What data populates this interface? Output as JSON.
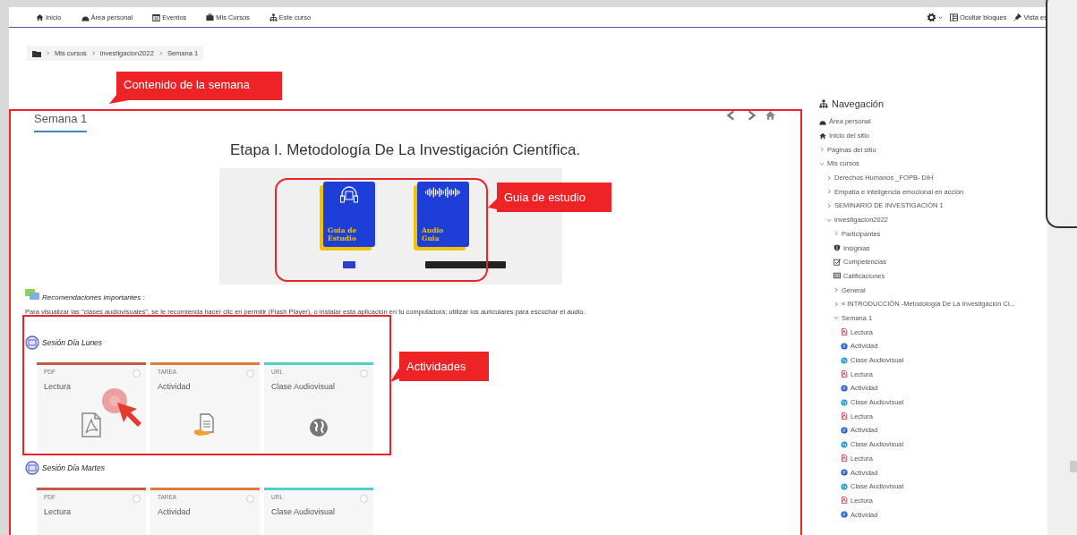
{
  "navbar": {
    "items": [
      {
        "kind": "home",
        "label": "Inicio"
      },
      {
        "kind": "dashboard",
        "label": "Área personal"
      },
      {
        "kind": "calendar",
        "label": "Eventos"
      },
      {
        "kind": "briefcase",
        "label": "Mis Cursos"
      },
      {
        "kind": "sitemap",
        "label": "Este curso"
      }
    ],
    "right": [
      {
        "kind": "gear"
      },
      {
        "kind": "columns",
        "label": "Ocultar bloques"
      },
      {
        "kind": "pin",
        "label": "Vista es"
      }
    ]
  },
  "breadcrumb": [
    "Mis cursos",
    "investigacion2022",
    "Semana 1"
  ],
  "section": {
    "tab": "Semana 1",
    "title": "Etapa I. Metodología De La Investigación Científica.",
    "covers": [
      {
        "kind": "book",
        "title": "Guia de Estudio"
      },
      {
        "kind": "audio",
        "title": "Audio Guia"
      }
    ],
    "notice_title": "Recomendaciones importantes :",
    "notice": "Para visualizar las \"clases audiovisuales\", se le recomienda hacer clic en permitir (Flash Player), o  instalar esta aplicación en tu computadora; utilizar  los auriculares para escuchar el audio.",
    "sessions": [
      {
        "title": "Sesión Día Lunes",
        "activities": [
          {
            "kind": "pdf",
            "type": "PDF",
            "name": "Lectura",
            "done": false
          },
          {
            "kind": "task",
            "type": "TAREA",
            "name": "Actividad",
            "done": false
          },
          {
            "kind": "url",
            "type": "URL",
            "name": "Clase Audiovisual",
            "done": false
          }
        ]
      },
      {
        "title": "Sesión Día Martes",
        "activities": [
          {
            "kind": "pdf",
            "type": "PDF",
            "name": "Lectura",
            "done": false
          },
          {
            "kind": "task",
            "type": "TAREA",
            "name": "Actividad",
            "done": false
          },
          {
            "kind": "url",
            "type": "URL",
            "name": "Clase Audiovisual",
            "done": false
          }
        ]
      }
    ]
  },
  "navigation": {
    "title": "Navegación",
    "items": [
      {
        "kind": "dashboard",
        "label": "Área personal"
      },
      {
        "kind": "home",
        "label": "Inicio del sitio"
      },
      {
        "kind": "branch",
        "label": "Páginas del sitio",
        "expanded": false
      },
      {
        "kind": "branch",
        "label": "Mis cursos",
        "expanded": true,
        "children": [
          {
            "kind": "branch",
            "label": "Derechos Humanos _FOPB- DIH",
            "expanded": false
          },
          {
            "kind": "branch",
            "label": "Empatía e inteligencia emocional en acción",
            "expanded": false
          },
          {
            "kind": "branch",
            "label": "SEMINARIO DE INVESTIGACIÓN 1",
            "expanded": false
          },
          {
            "kind": "branch",
            "label": "investigacion2022",
            "expanded": true,
            "children": [
              {
                "kind": "branch",
                "label": "Participantes",
                "expanded": false
              },
              {
                "kind": "badge",
                "label": "Insignias"
              },
              {
                "kind": "check",
                "label": "Competencias"
              },
              {
                "kind": "grades",
                "label": "Calificaciones"
              },
              {
                "kind": "branch",
                "label": "General",
                "expanded": false
              },
              {
                "kind": "branch",
                "label": "« INTRODUCCIÓN -Metodología De La Investigación Ci...",
                "expanded": false
              },
              {
                "kind": "branch",
                "label": "Semana 1",
                "expanded": true,
                "children": [
                  {
                    "kind": "pdf",
                    "label": "Lectura"
                  },
                  {
                    "kind": "task",
                    "label": "Actividad"
                  },
                  {
                    "kind": "url",
                    "label": "Clase Audiovisual"
                  },
                  {
                    "kind": "pdf",
                    "label": "Lectura"
                  },
                  {
                    "kind": "task",
                    "label": "Actividad"
                  },
                  {
                    "kind": "url",
                    "label": "Clase Audiovisual"
                  },
                  {
                    "kind": "pdf",
                    "label": "Lectura"
                  },
                  {
                    "kind": "task",
                    "label": "Actividad"
                  },
                  {
                    "kind": "url",
                    "label": "Clase Audiovisual"
                  },
                  {
                    "kind": "pdf",
                    "label": "Lectura"
                  },
                  {
                    "kind": "task",
                    "label": "Actividad"
                  },
                  {
                    "kind": "url",
                    "label": "Clase Audiovisual"
                  },
                  {
                    "kind": "pdf",
                    "label": "Lectura"
                  },
                  {
                    "kind": "task",
                    "label": "Actividad"
                  }
                ]
              }
            ]
          }
        ]
      }
    ]
  },
  "annotations": [
    {
      "kind": "callout",
      "text": "Contenido de la semana"
    },
    {
      "kind": "callout",
      "text": "Guia de estudio"
    },
    {
      "kind": "callout",
      "text": "Actividades"
    }
  ]
}
